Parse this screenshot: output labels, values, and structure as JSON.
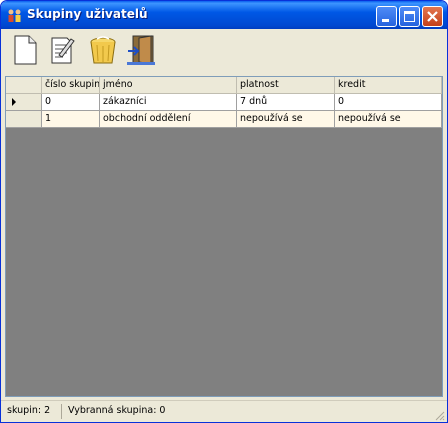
{
  "window": {
    "title": "Skupiny uživatelů"
  },
  "toolbar": {
    "items": [
      {
        "name": "new",
        "icon": "new-document-icon"
      },
      {
        "name": "edit",
        "icon": "edit-document-icon"
      },
      {
        "name": "delete",
        "icon": "recycle-bin-icon"
      },
      {
        "name": "exit",
        "icon": "exit-door-icon"
      }
    ]
  },
  "table": {
    "columns": [
      "číslo skupiny",
      "jméno",
      "platnost",
      "kredit"
    ],
    "rows": [
      {
        "id": "0",
        "name": "zákazníci",
        "validity": "7 dnů",
        "credit": "0",
        "current": true
      },
      {
        "id": "1",
        "name": "obchodní oddělení",
        "validity": "nepoužívá se",
        "credit": "nepoužívá se",
        "current": false
      }
    ]
  },
  "status": {
    "count": "skupin: 2",
    "selected": "Vybranná skupina: 0"
  },
  "colors": {
    "titlebar": "#0058e6",
    "grid_background": "#808080",
    "alt_row": "#fff8e8"
  }
}
